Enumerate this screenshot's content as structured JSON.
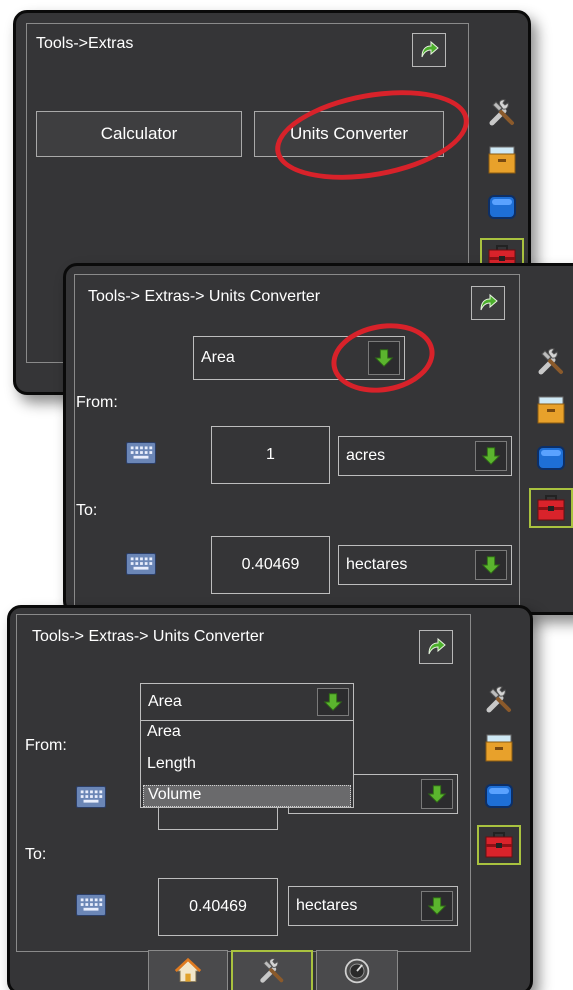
{
  "panel1": {
    "title": "Tools->Extras",
    "calculator_label": "Calculator",
    "units_converter_label": "Units Converter"
  },
  "panel2": {
    "title": "Tools-> Extras-> Units Converter",
    "category_value": "Area",
    "from_label": "From:",
    "from_value": "1",
    "from_unit": "acres",
    "to_label": "To:",
    "to_value": "0.40469",
    "to_unit": "hectares"
  },
  "panel3": {
    "title": "Tools-> Extras-> Units Converter",
    "category_value": "Area",
    "from_label": "From:",
    "to_label": "To:",
    "to_value": "0.40469",
    "to_unit": "hectares",
    "options": [
      "Area",
      "Length",
      "Volume"
    ]
  },
  "colors": {
    "panel_bg": "#353537",
    "highlight_red": "#d8222a",
    "active_tab_green": "#a9c23f",
    "arrow_green": "#5bb52e"
  },
  "icons": {
    "back": "back-arrow-icon",
    "tools": "tools-icon",
    "system_setup": "drawer-icon",
    "console": "monitor-icon",
    "extras": "toolbox-icon",
    "keyboard": "keyboard-icon",
    "home": "home-icon",
    "guidance": "speedometer-icon"
  }
}
